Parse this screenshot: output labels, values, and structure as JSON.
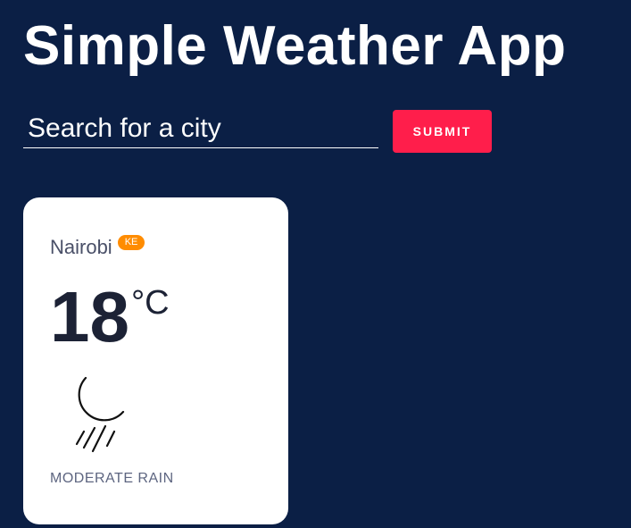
{
  "app": {
    "title": "Simple Weather App"
  },
  "search": {
    "placeholder": "Search for a city",
    "value": "",
    "submit_label": "SUBMIT"
  },
  "weather_card": {
    "city": "Nairobi",
    "country_code": "KE",
    "temperature": "18",
    "unit": "°C",
    "icon": "night-moon-rain-icon",
    "description": "MODERATE RAIN"
  },
  "colors": {
    "background": "#0b1f45",
    "accent": "#ff1e4b",
    "badge": "#ff8c00",
    "card": "#ffffff"
  }
}
